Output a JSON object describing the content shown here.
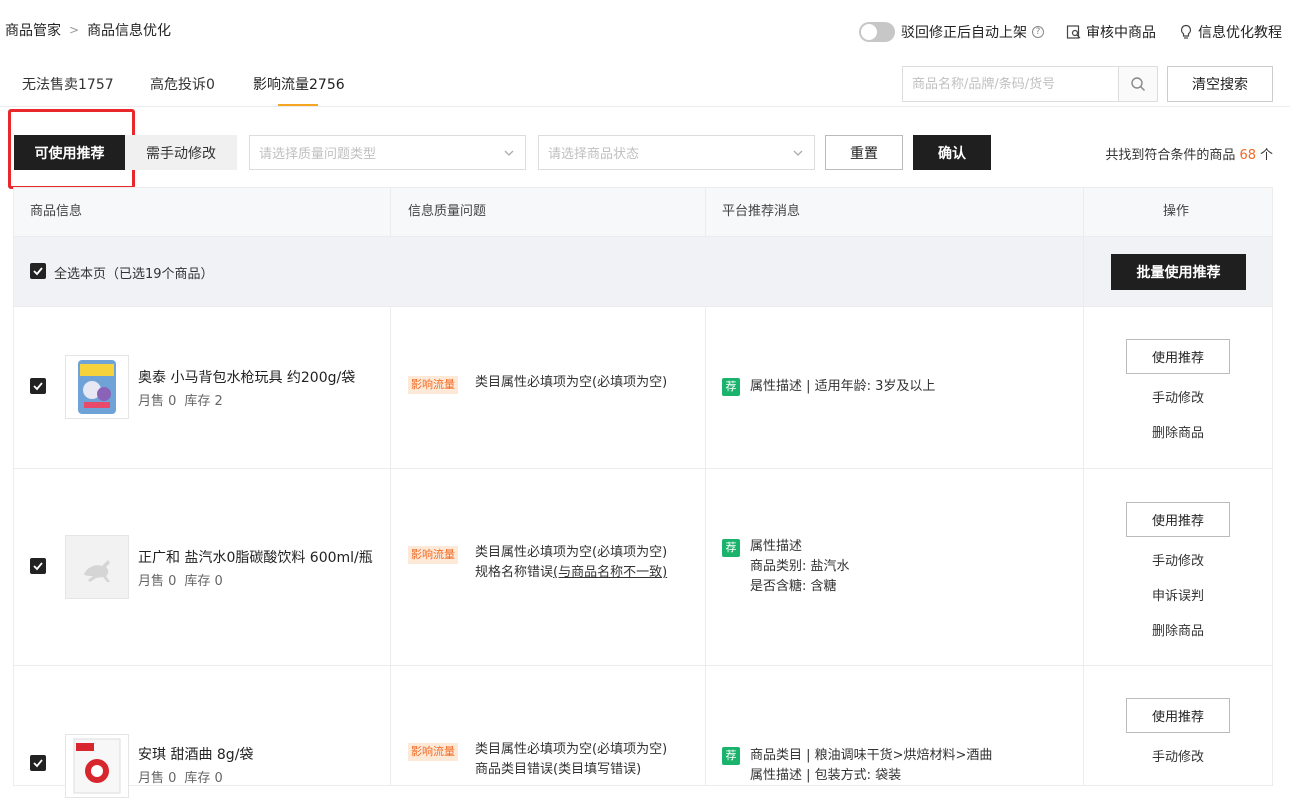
{
  "breadcrumb": {
    "root": "商品管家",
    "current": "商品信息优化"
  },
  "header": {
    "auto_relist_label": "驳回修正后自动上架",
    "reviewing_label": "审核中商品",
    "tutorial_label": "信息优化教程"
  },
  "tabs": [
    {
      "label": "无法售卖1757"
    },
    {
      "label": "高危投诉0"
    },
    {
      "label": "影响流量2756",
      "active": true
    }
  ],
  "search": {
    "placeholder": "商品名称/品牌/条码/货号",
    "value": "",
    "clear_label": "清空搜索"
  },
  "filters": {
    "usable_label": "可使用推荐",
    "manual_label": "需手动修改",
    "issue_type_placeholder": "请选择质量问题类型",
    "status_placeholder": "请选择商品状态",
    "reset_label": "重置",
    "confirm_label": "确认",
    "result_prefix": "共找到符合条件的商品",
    "result_count": "68",
    "result_suffix": "个"
  },
  "table": {
    "headers": {
      "product": "商品信息",
      "issue": "信息质量问题",
      "recommend": "平台推荐消息",
      "action": "操作"
    },
    "select_all_label": "全选本页（已选19个商品）",
    "batch_label": "批量使用推荐",
    "rows": [
      {
        "name": "奥泰 小马背包水枪玩具 约200g/袋",
        "sales": "月售 0",
        "stock": "库存 2",
        "tag": "影响流量",
        "issues": [
          "类目属性必填项为空(必填项为空)"
        ],
        "rec_badge": "荐",
        "rec_lines": [
          "属性描述 |  适用年龄: 3岁及以上"
        ],
        "actions": {
          "primary": "使用推荐",
          "links": [
            "手动修改",
            "删除商品"
          ]
        }
      },
      {
        "name": "正广和 盐汽水0脂碳酸饮料 600ml/瓶",
        "sales": "月售 0",
        "stock": "库存 0",
        "tag": "影响流量",
        "issues": [
          "类目属性必填项为空(必填项为空)",
          "规格名称错误(与商品名称不一致)"
        ],
        "rec_badge": "荐",
        "rec_lines": [
          "属性描述",
          "商品类别: 盐汽水",
          "是否含糖: 含糖"
        ],
        "actions": {
          "primary": "使用推荐",
          "links": [
            "手动修改",
            "申诉误判",
            "删除商品"
          ]
        }
      },
      {
        "name": "安琪 甜酒曲 8g/袋",
        "sales": "月售 0",
        "stock": "库存 0",
        "tag": "影响流量",
        "issues": [
          "类目属性必填项为空(必填项为空)",
          "商品类目错误(类目填写错误)"
        ],
        "rec_badge": "荐",
        "rec_lines": [
          "商品类目 |  粮油调味干货>烘焙材料>酒曲",
          "属性描述 |  包装方式: 袋装"
        ],
        "actions": {
          "primary": "使用推荐",
          "links": [
            "手动修改"
          ]
        }
      }
    ]
  }
}
